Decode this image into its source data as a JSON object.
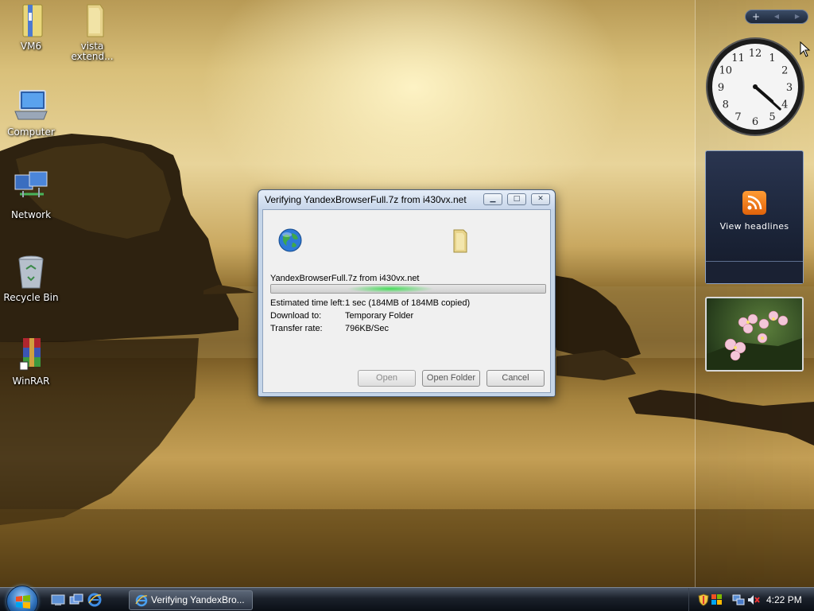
{
  "desktop": {
    "icons": [
      {
        "label": "VM6",
        "icon": "folder-zip-icon"
      },
      {
        "label": "vista extend...",
        "icon": "folder-icon"
      },
      {
        "label": "Computer",
        "icon": "computer-icon"
      },
      {
        "label": "Network",
        "icon": "network-icon"
      },
      {
        "label": "Recycle Bin",
        "icon": "recycle-bin-icon"
      },
      {
        "label": "WinRAR",
        "icon": "winrar-icon"
      }
    ]
  },
  "sidebar": {
    "controls": {
      "add": "+",
      "prev": "◀",
      "next": "▶"
    },
    "clock": {
      "hour_numerals": [
        "12",
        "1",
        "2",
        "3",
        "4",
        "5",
        "6",
        "7",
        "8",
        "9",
        "10",
        "11"
      ],
      "time_hour": 4,
      "time_minute": 22
    },
    "feed": {
      "label": "View headlines",
      "icon": "rss-icon"
    },
    "slideshow": {
      "subject": "flowers-photo"
    }
  },
  "dialog": {
    "title": "Verifying YandexBrowserFull.7z from i430vx.net",
    "caption_buttons": {
      "minimize": "▁",
      "maximize": "□",
      "close": "✕"
    },
    "filename": "YandexBrowserFull.7z from i430vx.net",
    "progress_fraction": 1.0,
    "fields": [
      {
        "label": "Estimated time left:",
        "value": "1 sec (184MB of 184MB copied)"
      },
      {
        "label": "Download to:",
        "value": "Temporary Folder"
      },
      {
        "label": "Transfer rate:",
        "value": "796KB/Sec"
      }
    ],
    "buttons": {
      "open": "Open",
      "open_folder": "Open Folder",
      "cancel": "Cancel"
    }
  },
  "taskbar": {
    "task_label": "Verifying YandexBro...",
    "clock": "4:22 PM",
    "quick_launch": [
      "show-desktop-icon",
      "switch-windows-icon",
      "internet-explorer-icon"
    ],
    "tray": [
      "security-shield-icon",
      "windows-update-icon",
      "network-status-icon",
      "volume-muted-icon"
    ]
  },
  "colors": {
    "dialog_frame": "#c5d5e8",
    "progress_glow": "#3cdc50",
    "taskbar": "#1b212b",
    "rss_orange": "#f07a1a"
  }
}
